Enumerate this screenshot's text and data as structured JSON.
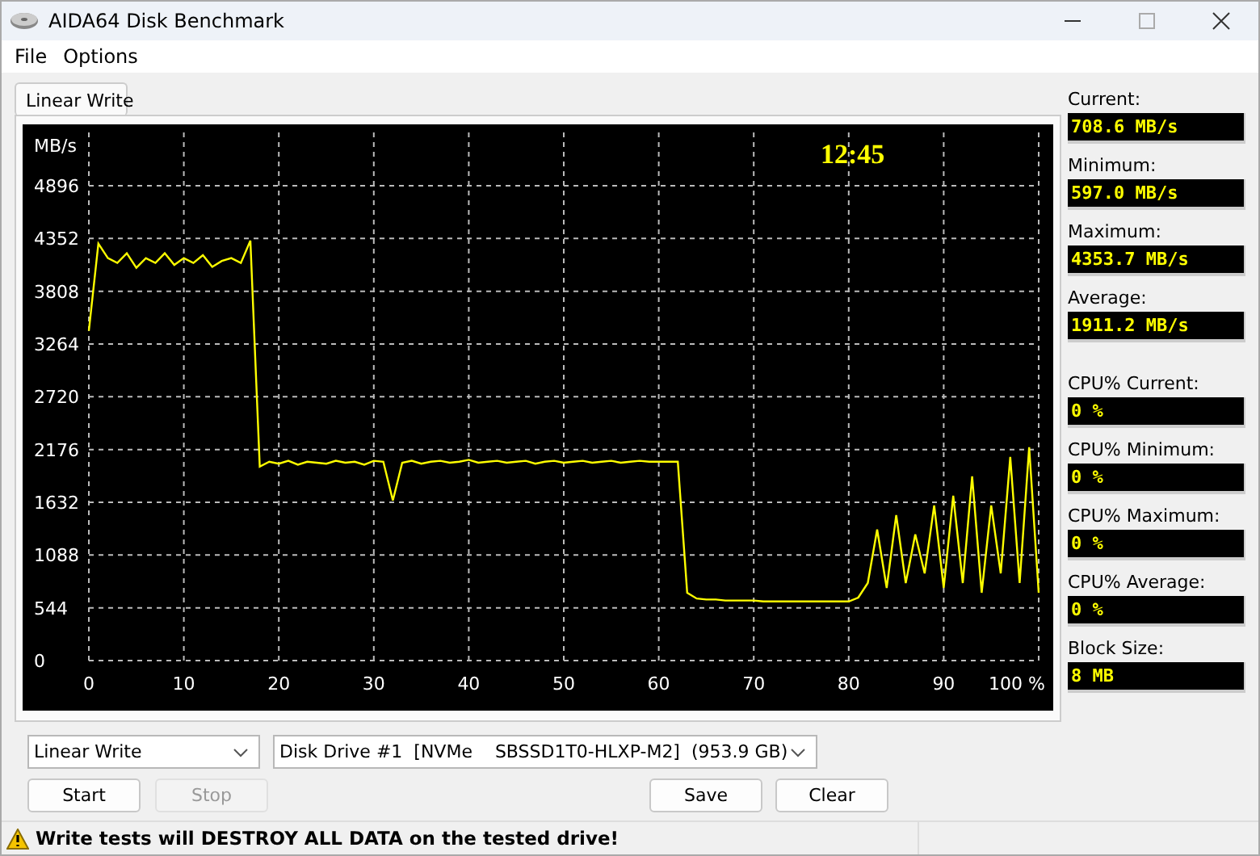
{
  "window": {
    "title": "AIDA64 Disk Benchmark"
  },
  "menu": [
    {
      "label": "File"
    },
    {
      "label": "Options"
    }
  ],
  "tabs": [
    {
      "label": "Linear Write",
      "selected": true
    }
  ],
  "chart": {
    "timer": "12:45",
    "chart_data": {
      "type": "line",
      "ylabel": "MB/s",
      "xlim": [
        0,
        100
      ],
      "ylim": [
        0,
        4896
      ],
      "xticks": [
        0,
        10,
        20,
        30,
        40,
        50,
        60,
        70,
        80,
        90,
        {
          "value": 100,
          "label": "100 %"
        }
      ],
      "yticks": [
        0,
        544,
        1088,
        1632,
        2176,
        2720,
        3264,
        3808,
        4352,
        4896
      ],
      "x": [
        0,
        1,
        2,
        3,
        4,
        5,
        6,
        7,
        8,
        9,
        10,
        11,
        12,
        13,
        14,
        15,
        16,
        17,
        18,
        19,
        20,
        21,
        22,
        23,
        24,
        25,
        26,
        27,
        28,
        29,
        30,
        31,
        32,
        33,
        34,
        35,
        36,
        37,
        38,
        39,
        40,
        41,
        42,
        43,
        44,
        45,
        46,
        47,
        48,
        49,
        50,
        51,
        52,
        53,
        54,
        55,
        56,
        57,
        58,
        59,
        60,
        61,
        62,
        63,
        64,
        65,
        66,
        67,
        68,
        69,
        70,
        71,
        72,
        73,
        74,
        75,
        76,
        77,
        78,
        79,
        80,
        81,
        82,
        83,
        84,
        85,
        86,
        87,
        88,
        89,
        90,
        91,
        92,
        93,
        94,
        95,
        96,
        97,
        98,
        99,
        100
      ],
      "grid": true,
      "series": [
        {
          "color": "#ffff00",
          "values": [
            3400,
            4300,
            4150,
            4100,
            4200,
            4050,
            4150,
            4100,
            4200,
            4080,
            4150,
            4100,
            4180,
            4060,
            4120,
            4150,
            4100,
            4330,
            2000,
            2050,
            2030,
            2060,
            2020,
            2050,
            2040,
            2030,
            2060,
            2040,
            2050,
            2020,
            2060,
            2050,
            1650,
            2040,
            2060,
            2030,
            2050,
            2060,
            2040,
            2050,
            2070,
            2040,
            2050,
            2060,
            2040,
            2050,
            2060,
            2030,
            2050,
            2060,
            2040,
            2050,
            2060,
            2040,
            2050,
            2060,
            2040,
            2050,
            2060,
            2050,
            2050,
            2050,
            2050,
            700,
            640,
            630,
            630,
            620,
            620,
            620,
            620,
            610,
            610,
            610,
            610,
            610,
            610,
            610,
            610,
            610,
            610,
            650,
            800,
            1350,
            750,
            1500,
            800,
            1300,
            900,
            1600,
            750,
            1700,
            800,
            1900,
            700,
            1600,
            900,
            2100,
            800,
            2200,
            700
          ]
        }
      ]
    }
  },
  "stats": [
    {
      "label": "Current:",
      "value": "708.6 MB/s"
    },
    {
      "label": "Minimum:",
      "value": "597.0 MB/s"
    },
    {
      "label": "Maximum:",
      "value": "4353.7 MB/s"
    },
    {
      "label": "Average:",
      "value": "1911.2 MB/s"
    },
    {
      "label": "CPU% Current:",
      "value": "0 %"
    },
    {
      "label": "CPU% Minimum:",
      "value": "0 %"
    },
    {
      "label": "CPU% Maximum:",
      "value": "0 %"
    },
    {
      "label": "CPU% Average:",
      "value": "0 %"
    },
    {
      "label": "Block Size:",
      "value": "8 MB"
    }
  ],
  "test_select": {
    "value": "Linear Write"
  },
  "drive_select": {
    "value": "Disk Drive #1  [NVMe    SBSSD1T0-HLXP-M2]  (953.9 GB)"
  },
  "buttons": [
    {
      "label": "Start",
      "disabled": false
    },
    {
      "label": "Stop",
      "disabled": true
    },
    {
      "label": "Save",
      "disabled": false
    },
    {
      "label": "Clear",
      "disabled": false
    }
  ],
  "status_bar": {
    "warning": "Write tests will DESTROY ALL DATA on the tested drive!"
  }
}
